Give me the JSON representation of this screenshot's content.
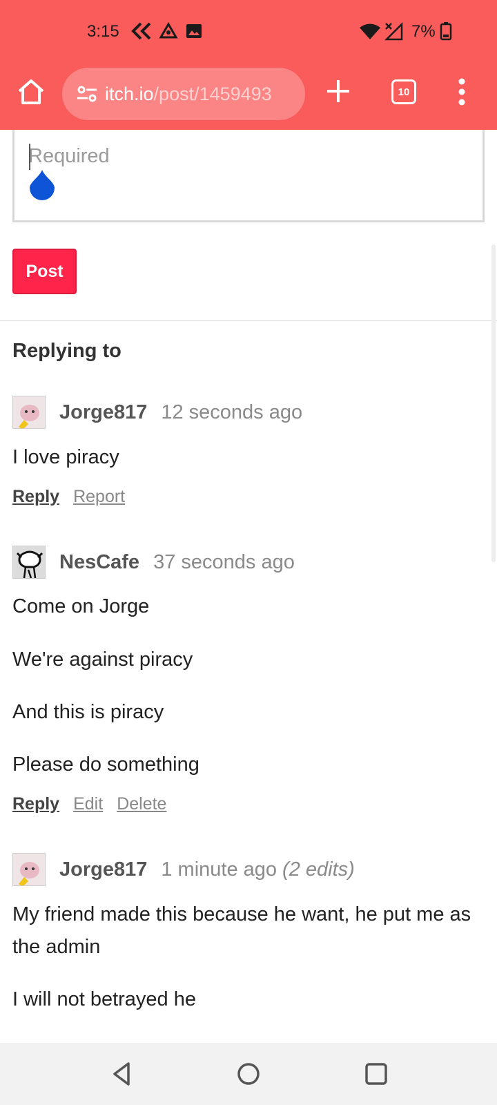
{
  "status": {
    "time": "3:15",
    "battery": "7%"
  },
  "browser": {
    "url_host": "itch.io",
    "url_path": "/post/1459493",
    "tab_count": "10"
  },
  "form": {
    "placeholder": "Required",
    "post_label": "Post"
  },
  "thread": {
    "heading": "Replying to",
    "comments": [
      {
        "user": "Jorge817",
        "time": "12 seconds ago",
        "edits": "",
        "paragraphs": [
          "I love piracy"
        ],
        "actions": [
          "Reply",
          "Report"
        ]
      },
      {
        "user": "NesCafe",
        "time": "37 seconds ago",
        "edits": "",
        "paragraphs": [
          "Come on Jorge",
          "We're against piracy",
          "And this is piracy",
          "Please do something"
        ],
        "actions": [
          "Reply",
          "Edit",
          "Delete"
        ]
      },
      {
        "user": "Jorge817",
        "time": "1 minute ago",
        "edits": "(2 edits)",
        "paragraphs": [
          "My friend made this because he want, he put me as the admin",
          "I will not betrayed he"
        ],
        "actions": []
      }
    ]
  },
  "colors": {
    "accent": "#fa5c5c",
    "post_button": "#ff2449",
    "drop_handle": "#0d55d6"
  }
}
